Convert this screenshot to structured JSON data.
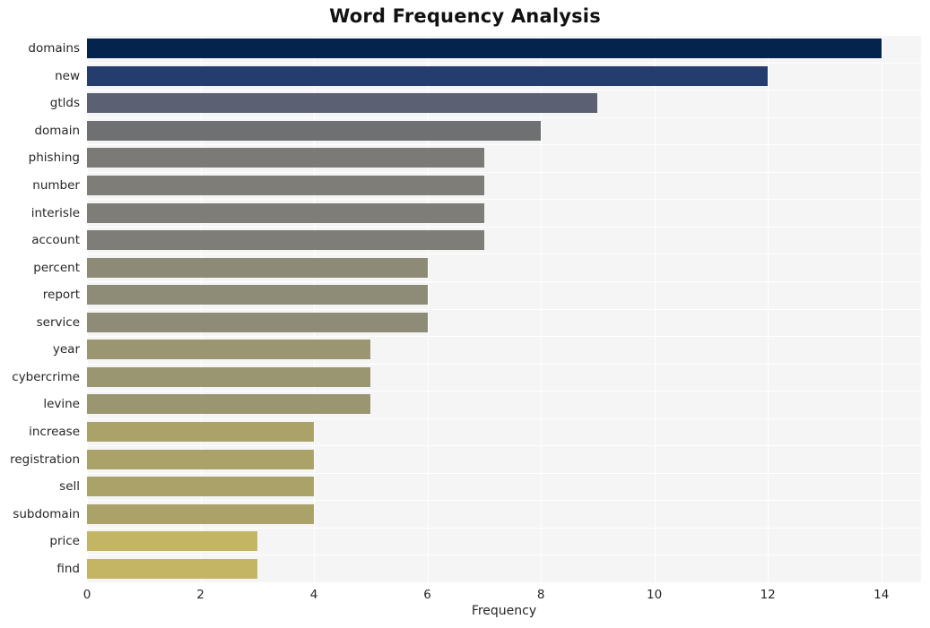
{
  "chart_data": {
    "type": "bar",
    "orientation": "horizontal",
    "title": "Word Frequency Analysis",
    "xlabel": "Frequency",
    "ylabel": "",
    "xlim": [
      0,
      14.7
    ],
    "ylim": [
      0,
      20
    ],
    "xticks": [
      0,
      2,
      4,
      6,
      8,
      10,
      12,
      14
    ],
    "xtick_labels": [
      "0",
      "2",
      "4",
      "6",
      "8",
      "10",
      "12",
      "14"
    ],
    "grid": true,
    "grid_color": "#ffffff",
    "plot_background": "#f5f5f5",
    "figure_background": "#ffffff",
    "legend": null,
    "categories": [
      "domains",
      "new",
      "gtlds",
      "domain",
      "phishing",
      "number",
      "interisle",
      "account",
      "percent",
      "report",
      "service",
      "year",
      "cybercrime",
      "levine",
      "increase",
      "registration",
      "sell",
      "subdomain",
      "price",
      "find"
    ],
    "values": [
      14,
      12,
      9,
      8,
      7,
      7,
      7,
      7,
      6,
      6,
      6,
      5,
      5,
      5,
      4,
      4,
      4,
      4,
      3,
      3
    ],
    "bar_colors": [
      "#04234d",
      "#253d6e",
      "#5b6073",
      "#6e7072",
      "#7b7a76",
      "#7e7d78",
      "#7e7d78",
      "#7e7d78",
      "#8d8a76",
      "#8e8b77",
      "#8e8b77",
      "#9b9672",
      "#9b9672",
      "#9b9672",
      "#aba269",
      "#aba269",
      "#aba269",
      "#aba269",
      "#c3b563",
      "#c3b563"
    ]
  }
}
